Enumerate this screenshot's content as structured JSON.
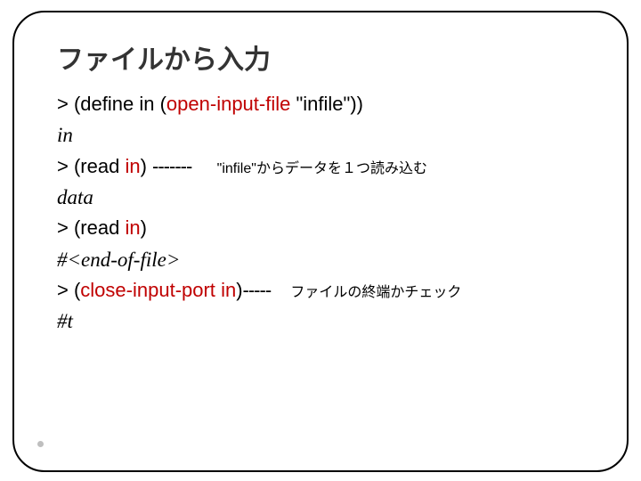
{
  "title": "ファイルから入力",
  "lines": {
    "l1_prompt": "> ",
    "l1_a": "(define in (",
    "l1_b": "open-input-file",
    "l1_c": " \"infile\"))",
    "l2": "in",
    "l3_prompt": "> ",
    "l3_a": "(read ",
    "l3_b": "in",
    "l3_c": ")",
    "l3_dash": "-------",
    "l3_note": "\"infile\"からデータを１つ読み込む",
    "l4": "data",
    "l5_prompt": "> ",
    "l5_a": "(read ",
    "l5_b": "in",
    "l5_c": ")",
    "l6": "#<end-of-file>",
    "l7_prompt": "> ",
    "l7_a": "(",
    "l7_b": "close-input-port",
    "l7_c": " ",
    "l7_d": "in",
    "l7_e": ")",
    "l7_dash": "-----",
    "l7_note": "ファイルの終端かチェック",
    "l8": "#t"
  }
}
